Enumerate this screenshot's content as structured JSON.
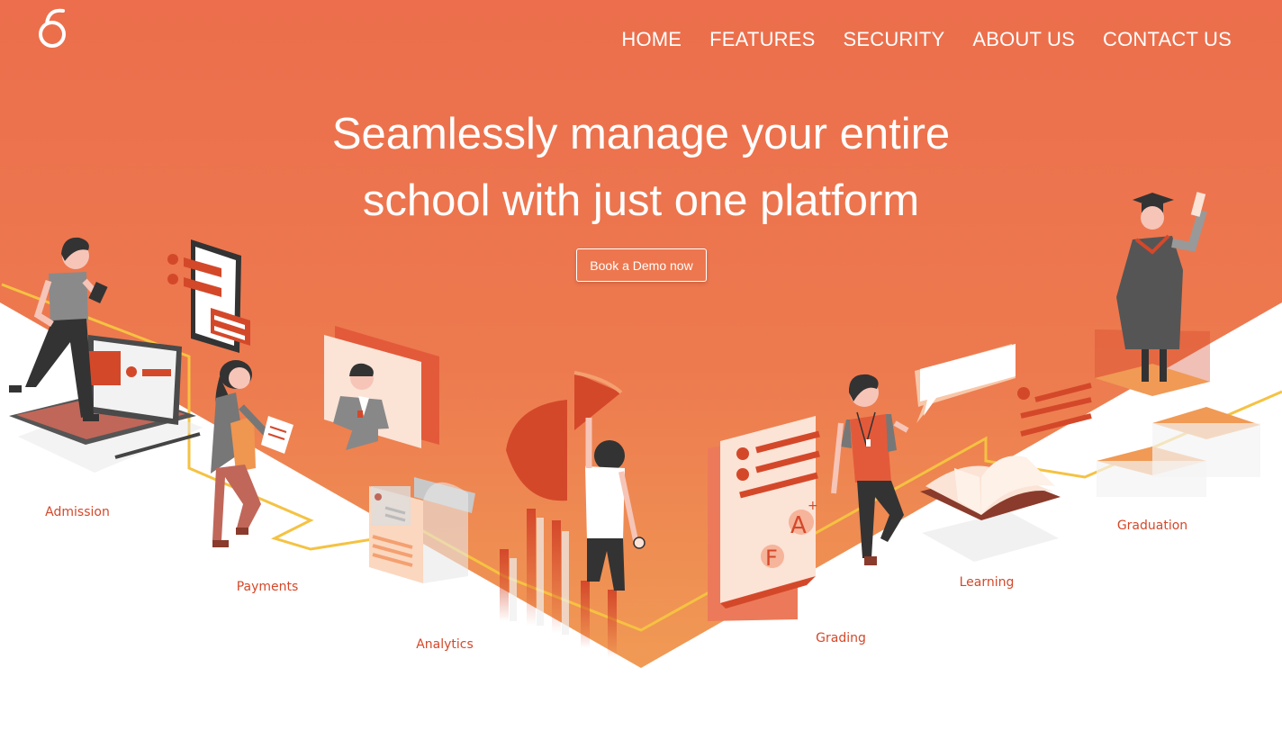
{
  "brand": {
    "logo_icon": "sigma-logo-icon"
  },
  "nav": {
    "items": [
      "HOME",
      "FEATURES",
      "SECURITY",
      "ABOUT US",
      "CONTACT US"
    ]
  },
  "hero": {
    "headline_line1": "Seamlessly manage your entire",
    "headline_line2": "school with just one platform",
    "cta_label": "Book a Demo now"
  },
  "stages": {
    "admission": "Admission",
    "payments": "Payments",
    "analytics": "Analytics",
    "grading": "Grading",
    "learning": "Learning",
    "graduation": "Graduation"
  },
  "illustration": {
    "grade_a": "A",
    "grade_plus": "+",
    "grade_f": "F"
  },
  "colors": {
    "hero_top": "#ec6e4c",
    "hero_bottom": "#f09a55",
    "accent_red": "#d4482a",
    "path_yellow": "#f5c242"
  }
}
